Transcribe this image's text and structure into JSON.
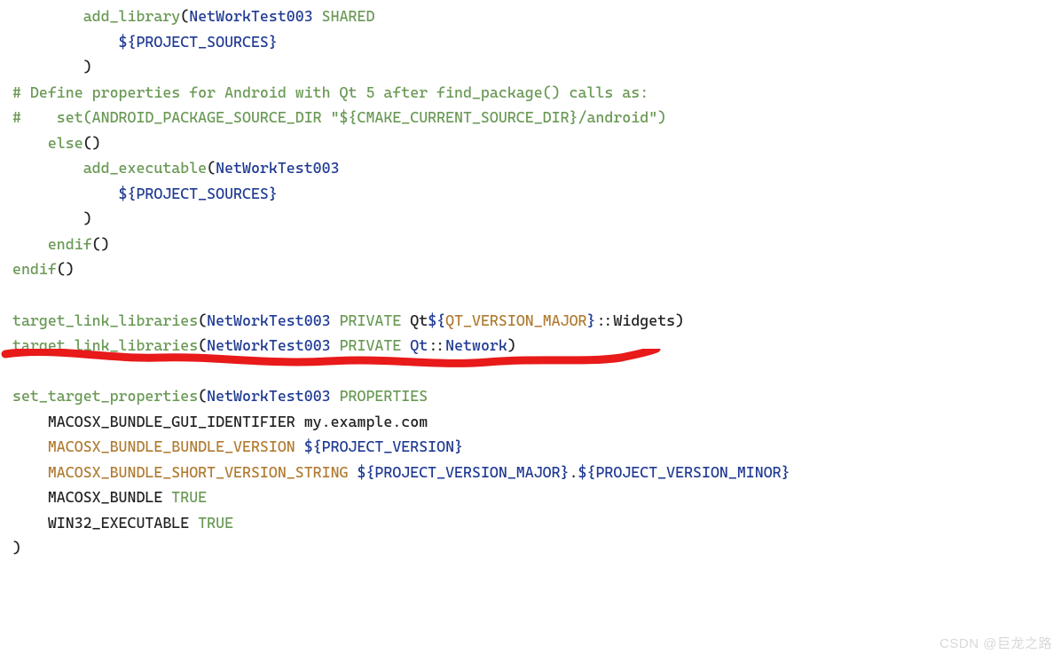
{
  "watermark": "CSDN @巨龙之路",
  "code_lines": [
    [
      [
        "pad",
        "        "
      ],
      [
        "fn",
        "add_library"
      ],
      [
        "plain",
        "("
      ],
      [
        "id",
        "NetWorkTest003"
      ],
      [
        "plain",
        " "
      ],
      [
        "kw",
        "SHARED"
      ]
    ],
    [
      [
        "pad",
        "            "
      ],
      [
        "brace",
        "${"
      ],
      [
        "var",
        "PROJECT_SOURCES"
      ],
      [
        "brace",
        "}"
      ]
    ],
    [
      [
        "pad",
        "        "
      ],
      [
        "plain",
        ")"
      ]
    ],
    [
      [
        "comment",
        "# Define properties for Android with Qt 5 after find_package() calls as:"
      ]
    ],
    [
      [
        "comment",
        "#    set(ANDROID_PACKAGE_SOURCE_DIR \"${CMAKE_CURRENT_SOURCE_DIR}/android\")"
      ]
    ],
    [
      [
        "pad",
        "    "
      ],
      [
        "fn",
        "else"
      ],
      [
        "plain",
        "()"
      ]
    ],
    [
      [
        "pad",
        "        "
      ],
      [
        "fn",
        "add_executable"
      ],
      [
        "plain",
        "("
      ],
      [
        "id",
        "NetWorkTest003"
      ]
    ],
    [
      [
        "pad",
        "            "
      ],
      [
        "brace",
        "${"
      ],
      [
        "var",
        "PROJECT_SOURCES"
      ],
      [
        "brace",
        "}"
      ]
    ],
    [
      [
        "pad",
        "        "
      ],
      [
        "plain",
        ")"
      ]
    ],
    [
      [
        "pad",
        "    "
      ],
      [
        "fn",
        "endif"
      ],
      [
        "plain",
        "()"
      ]
    ],
    [
      [
        "fn",
        "endif"
      ],
      [
        "plain",
        "()"
      ]
    ],
    [
      [
        "plain",
        ""
      ]
    ],
    [
      [
        "fn",
        "target_link_libraries"
      ],
      [
        "plain",
        "("
      ],
      [
        "id",
        "NetWorkTest003"
      ],
      [
        "plain",
        " "
      ],
      [
        "kw",
        "PRIVATE"
      ],
      [
        "plain",
        " Qt"
      ],
      [
        "brace",
        "${"
      ],
      [
        "qtvar",
        "QT_VERSION_MAJOR"
      ],
      [
        "brace",
        "}"
      ],
      [
        "plain",
        "::Widgets)"
      ]
    ],
    [
      [
        "fn",
        "target_link_libraries"
      ],
      [
        "plain",
        "("
      ],
      [
        "id",
        "NetWorkTest003"
      ],
      [
        "plain",
        " "
      ],
      [
        "kw",
        "PRIVATE"
      ],
      [
        "plain",
        " "
      ],
      [
        "id",
        "Qt"
      ],
      [
        "plain",
        "::"
      ],
      [
        "id",
        "Network"
      ],
      [
        "plain",
        ")"
      ]
    ],
    [
      [
        "plain",
        ""
      ]
    ],
    [
      [
        "fn",
        "set_target_properties"
      ],
      [
        "plain",
        "("
      ],
      [
        "id",
        "NetWorkTest003"
      ],
      [
        "plain",
        " "
      ],
      [
        "kw",
        "PROPERTIES"
      ]
    ],
    [
      [
        "pad",
        "    "
      ],
      [
        "plain",
        "MACOSX_BUNDLE_GUI_IDENTIFIER my.example.com"
      ]
    ],
    [
      [
        "pad",
        "    "
      ],
      [
        "prop",
        "MACOSX_BUNDLE_BUNDLE_VERSION"
      ],
      [
        "plain",
        " "
      ],
      [
        "brace",
        "${"
      ],
      [
        "var",
        "PROJECT_VERSION"
      ],
      [
        "brace",
        "}"
      ]
    ],
    [
      [
        "pad",
        "    "
      ],
      [
        "prop",
        "MACOSX_BUNDLE_SHORT_VERSION_STRING"
      ],
      [
        "plain",
        " "
      ],
      [
        "brace",
        "${"
      ],
      [
        "var",
        "PROJECT_VERSION_MAJOR"
      ],
      [
        "brace",
        "}"
      ],
      [
        "plain",
        "."
      ],
      [
        "brace",
        "${"
      ],
      [
        "var",
        "PROJECT_VERSION_MINOR"
      ],
      [
        "brace",
        "}"
      ]
    ],
    [
      [
        "pad",
        "    "
      ],
      [
        "plain",
        "MACOSX_BUNDLE "
      ],
      [
        "kw",
        "TRUE"
      ]
    ],
    [
      [
        "pad",
        "    "
      ],
      [
        "plain",
        "WIN32_EXECUTABLE "
      ],
      [
        "kw",
        "TRUE"
      ]
    ],
    [
      [
        "plain",
        ")"
      ]
    ]
  ]
}
